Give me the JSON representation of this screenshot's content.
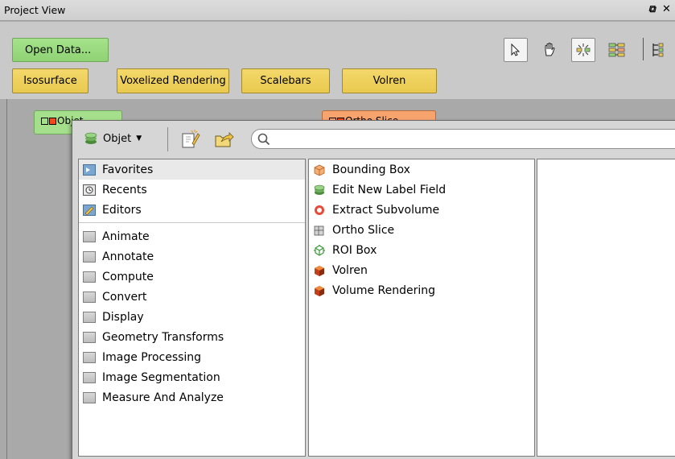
{
  "window": {
    "title": "Project View"
  },
  "toolbar": {
    "open_data_label": "Open Data...",
    "tools": [
      "select-pointer",
      "pan-hand",
      "auto-connect",
      "tree-view",
      "layout"
    ]
  },
  "modules": [
    {
      "label": "Isosurface"
    },
    {
      "label": "Voxelized Rendering"
    },
    {
      "label": "Scalebars"
    },
    {
      "label": "Volren"
    }
  ],
  "graph": {
    "nodes": [
      {
        "label": "Objet",
        "color": "#a5df8b"
      },
      {
        "label": "Ortho Slice",
        "color": "#f6a36e"
      }
    ]
  },
  "popup": {
    "object_label": "Objet",
    "search": {
      "value": "",
      "placeholder": ""
    },
    "categories": [
      {
        "label": "Favorites",
        "icon": "favorites-folder-icon",
        "selected": true
      },
      {
        "label": "Recents",
        "icon": "recents-icon"
      },
      {
        "label": "Editors",
        "icon": "editors-icon"
      },
      {
        "label": "Animate",
        "icon": "folder-icon"
      },
      {
        "label": "Annotate",
        "icon": "folder-icon"
      },
      {
        "label": "Compute",
        "icon": "folder-icon"
      },
      {
        "label": "Convert",
        "icon": "folder-icon"
      },
      {
        "label": "Display",
        "icon": "folder-icon"
      },
      {
        "label": "Geometry Transforms",
        "icon": "folder-icon"
      },
      {
        "label": "Image Processing",
        "icon": "folder-icon"
      },
      {
        "label": "Image Segmentation",
        "icon": "folder-icon"
      },
      {
        "label": "Measure And Analyze",
        "icon": "folder-icon"
      }
    ],
    "favorites": [
      {
        "label": "Bounding Box",
        "icon": "bounding-box-icon"
      },
      {
        "label": "Edit New Label Field",
        "icon": "label-field-icon"
      },
      {
        "label": "Extract Subvolume",
        "icon": "extract-subvolume-icon"
      },
      {
        "label": "Ortho Slice",
        "icon": "ortho-slice-icon"
      },
      {
        "label": "ROI Box",
        "icon": "roi-box-icon"
      },
      {
        "label": "Volren",
        "icon": "volren-icon"
      },
      {
        "label": "Volume Rendering",
        "icon": "volume-rendering-icon"
      }
    ]
  },
  "colors": {
    "module_yellow": "#e9c94f",
    "green_button": "#8fd274",
    "orange_node": "#f6a36e"
  }
}
